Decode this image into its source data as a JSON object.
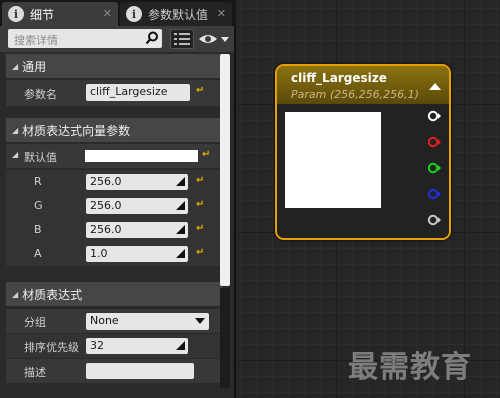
{
  "tabs": [
    {
      "label": "细节",
      "icon": "info-icon",
      "active": true
    },
    {
      "label": "参数默认值",
      "icon": "info-icon",
      "active": false
    }
  ],
  "search": {
    "placeholder": "搜索详情"
  },
  "sections": {
    "general": "通用",
    "vector_params": "材质表达式向量参数",
    "expression": "材质表达式"
  },
  "general": {
    "param_name_label": "参数名",
    "param_name_value": "cliff_Largesize"
  },
  "vector": {
    "default_label": "默认值",
    "default_color": "#ffffff",
    "components": [
      {
        "label": "R",
        "value": "256.0"
      },
      {
        "label": "G",
        "value": "256.0"
      },
      {
        "label": "B",
        "value": "256.0"
      },
      {
        "label": "A",
        "value": "1.0"
      }
    ]
  },
  "expression": {
    "group_label": "分组",
    "group_value": "None",
    "priority_label": "排序优先级",
    "priority_value": "32",
    "desc_label": "描述",
    "desc_value": ""
  },
  "node": {
    "title": "cliff_Largesize",
    "subtitle": "Param (256,256,256,1)",
    "preview_color": "#ffffff",
    "pins": [
      {
        "name": "output",
        "color": "#ffffff"
      },
      {
        "name": "r",
        "color": "#e02020"
      },
      {
        "name": "g",
        "color": "#20d020"
      },
      {
        "name": "b",
        "color": "#2030e0"
      },
      {
        "name": "a",
        "color": "#c8c8c8"
      }
    ]
  },
  "watermark": "最需教育",
  "colors": {
    "accent": "#e8a000",
    "reset": "#e0b000"
  }
}
